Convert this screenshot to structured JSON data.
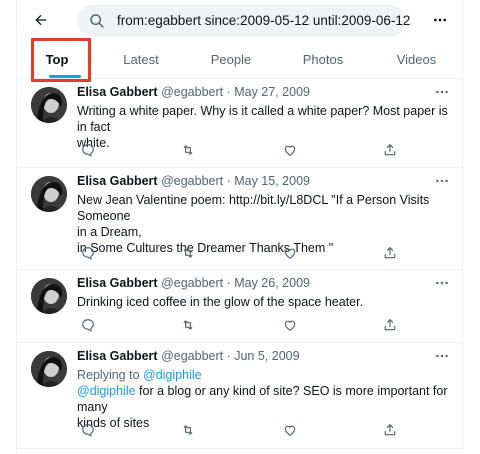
{
  "header": {
    "back_icon": "back-arrow-icon",
    "search_query": "from:egabbert since:2009-05-12 until:2009-06-12",
    "more_icon": "more-horizontal-icon"
  },
  "tabs": [
    {
      "label": "Top",
      "active": true
    },
    {
      "label": "Latest",
      "active": false
    },
    {
      "label": "People",
      "active": false
    },
    {
      "label": "Photos",
      "active": false
    },
    {
      "label": "Videos",
      "active": false
    }
  ],
  "colors": {
    "accent": "#1d9bf0",
    "highlight_border": "#e33b2e",
    "text": "#0f1419",
    "muted": "#536471"
  },
  "tweets": [
    {
      "name": "Elisa Gabbert",
      "meta": "@egabbert · May 27, 2009",
      "lines": [
        "Writing a white paper. Why is it called a white paper? Most paper is in fact",
        "white."
      ]
    },
    {
      "name": "Elisa Gabbert",
      "meta": "@egabbert · May 15, 2009",
      "lines": [
        "New Jean Valentine poem: http://bit.ly/L8DCL \"If a Person Visits Someone",
        "in a Dream,",
        "in Some Cultures the Dreamer Thanks Them \""
      ]
    },
    {
      "name": "Elisa Gabbert",
      "meta": "@egabbert · May 26, 2009",
      "lines": [
        "Drinking iced coffee in the glow of the space heater."
      ]
    },
    {
      "name": "Elisa Gabbert",
      "meta": "@egabbert · Jun 5, 2009",
      "reply_prefix": "Replying to ",
      "reply_to": "@digiphile",
      "mention": "@digiphile",
      "lines": [
        " for a blog or any kind of site? SEO is more important for many",
        "kinds of sites"
      ]
    }
  ]
}
